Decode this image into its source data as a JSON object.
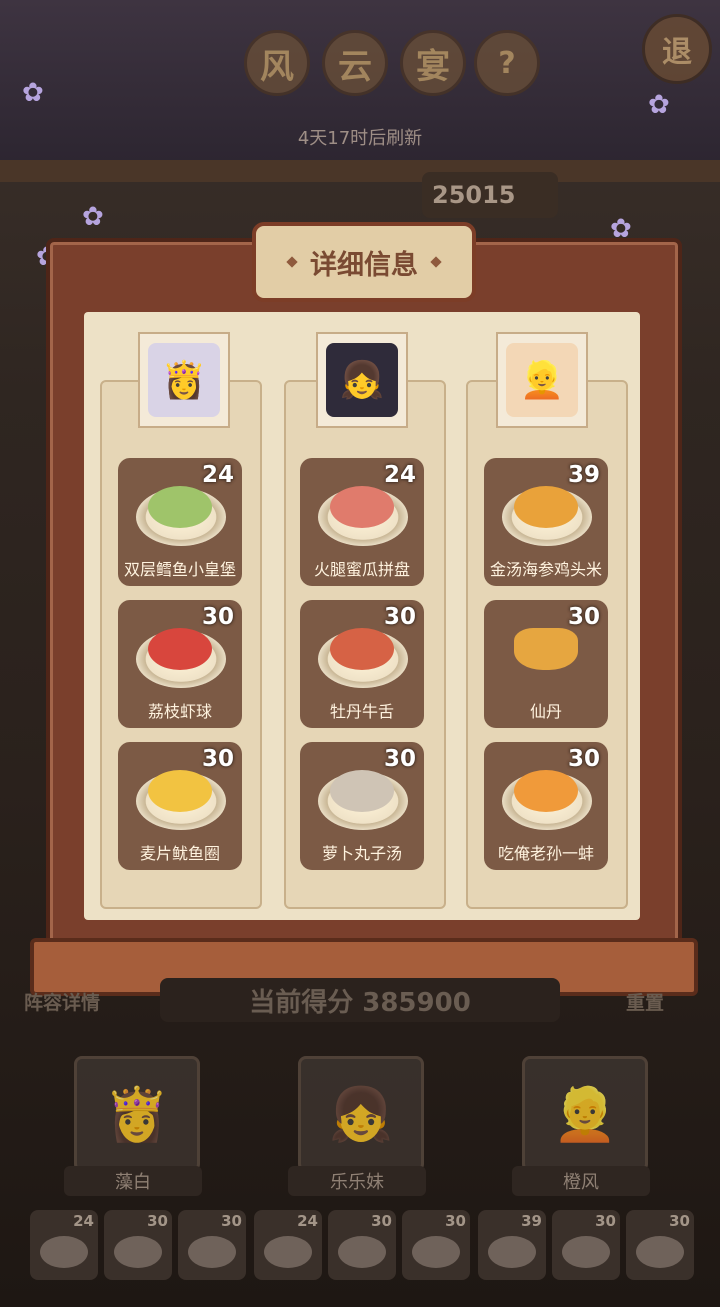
{
  "header": {
    "title_chars": [
      "风",
      "云",
      "宴"
    ],
    "help_icon": "?",
    "exit_label": "退",
    "refresh_text": "4天17时后刷新",
    "top_score": "25015"
  },
  "panel": {
    "title": "详细信息",
    "columns": [
      {
        "character": "藻白",
        "portrait_color": "#d9d3e6",
        "dishes": [
          {
            "name": "双层鳕鱼小皇堡",
            "value": "24",
            "food_color": "#9fc46a"
          },
          {
            "name": "荔枝虾球",
            "value": "30",
            "food_color": "#d8463d"
          },
          {
            "name": "麦片鱿鱼圈",
            "value": "30",
            "food_color": "#f2c341"
          }
        ]
      },
      {
        "character": "乐乐妹",
        "portrait_color": "#2f2b3a",
        "dishes": [
          {
            "name": "火腿蜜瓜拼盘",
            "value": "24",
            "food_color": "#e07b6c"
          },
          {
            "name": "牡丹牛舌",
            "value": "30",
            "food_color": "#d66245"
          },
          {
            "name": "萝卜丸子汤",
            "value": "30",
            "food_color": "#cfc4b5"
          }
        ]
      },
      {
        "character": "橙风",
        "portrait_color": "#f3d7b6",
        "dishes": [
          {
            "name": "金汤海参鸡头米",
            "value": "39",
            "food_color": "#e9a23a"
          },
          {
            "name": "仙丹",
            "value": "30",
            "food_color": "#e6a640"
          },
          {
            "name": "吃俺老孙一蚌",
            "value": "30",
            "food_color": "#f09a3a"
          }
        ]
      }
    ]
  },
  "bottom": {
    "lineup_label": "阵容详情",
    "score_text": "当前得分 385900",
    "reset_label": "重置",
    "heroes": [
      "藻白",
      "乐乐妹",
      "橙风"
    ],
    "mini_values": [
      "24",
      "30",
      "30",
      "24",
      "30",
      "30",
      "39",
      "30",
      "30"
    ]
  }
}
